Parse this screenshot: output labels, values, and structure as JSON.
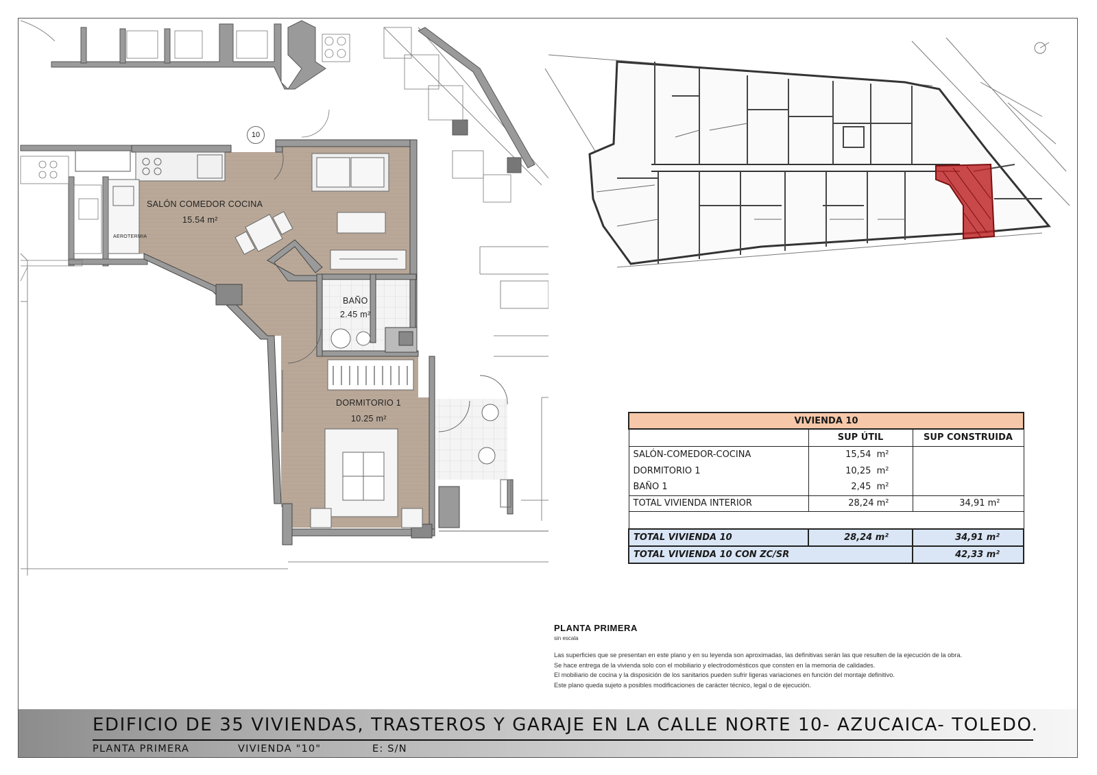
{
  "plan": {
    "unit_number": "10",
    "rooms": [
      {
        "name": "SALÓN COMEDOR COCINA",
        "area": "15.54 m²"
      },
      {
        "name": "BAÑO",
        "area": "2.45 m²"
      },
      {
        "name": "DORMITORIO 1",
        "area": "10.25 m²"
      }
    ],
    "aerotermia": "AEROTERMIA"
  },
  "table": {
    "title": "VIVIENDA 10",
    "col_util": "SUP ÚTIL",
    "col_construida": "SUP CONSTRUIDA",
    "rows": [
      {
        "label": "SALÓN-COMEDOR-COCINA",
        "util": "15,54",
        "unit": "m²"
      },
      {
        "label": "DORMITORIO 1",
        "util": "10,25",
        "unit": "m²"
      },
      {
        "label": "BAÑO 1",
        "util": "2,45",
        "unit": "m²"
      }
    ],
    "total_interior": {
      "label": "TOTAL VIVIENDA INTERIOR",
      "util": "28,24 m²",
      "construida": "34,91 m²"
    },
    "total_vivienda": {
      "label": "TOTAL VIVIENDA 10",
      "util": "28,24  m²",
      "construida": "34,91  m²"
    },
    "total_zc": {
      "label": "TOTAL VIVIENDA 10 CON ZC/SR",
      "construida": "42,33  m²"
    }
  },
  "notes": {
    "title": "PLANTA PRIMERA",
    "subtitle": "sin escala",
    "lines": [
      "Las superficies que se presentan en este plano y en su leyenda son aproximadas, las definitivas serán las que resulten de la ejecución de la obra.",
      "Se hace entrega de la vivienda solo con el mobiliario y electrodomésticos que consten en la memoria de calidades.",
      "El mobiliario de cocina y la disposición de los sanitarios pueden sufrir ligeras variaciones en función del montaje definitivo.",
      "Este plano queda sujeto a posibles modificaciones de carácter técnico, legal o de ejecución."
    ]
  },
  "banner": {
    "title": "EDIFICIO DE 35 VIVIENDAS, TRASTEROS Y GARAJE EN LA CALLE NORTE 10- AZUCAICA-  TOLEDO.",
    "floor": "PLANTA PRIMERA",
    "unit": "VIVIENDA \"10\"",
    "scale": "E: S/N"
  },
  "colors": {
    "highlight": "#c0282a",
    "floor": "#b7a697",
    "header": "#f6c7a8",
    "totals": "#dae6f6"
  }
}
